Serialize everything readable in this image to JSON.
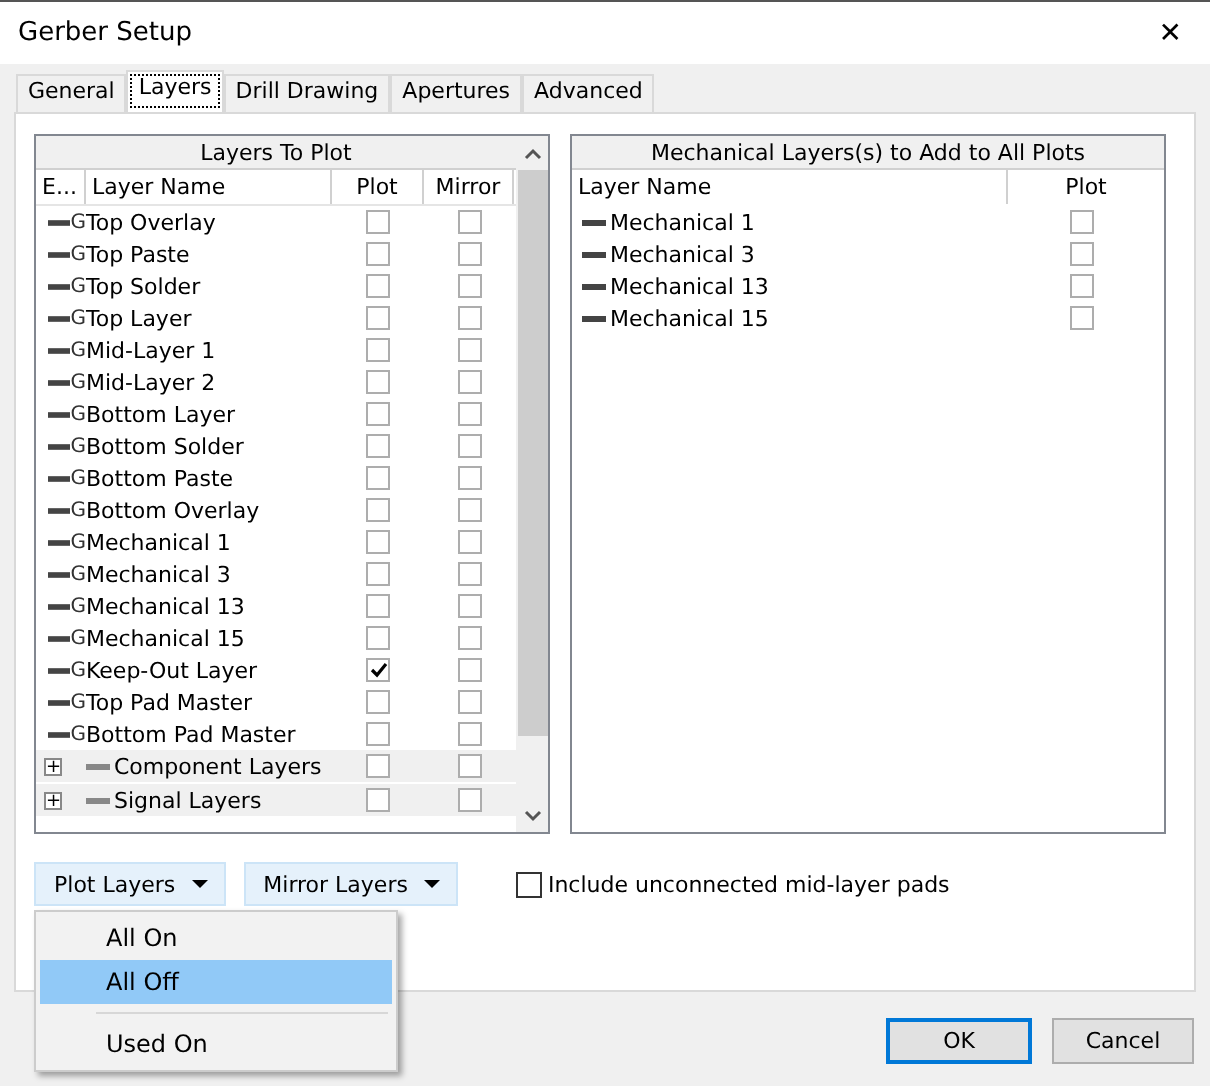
{
  "window": {
    "title": "Gerber Setup",
    "close": "✕"
  },
  "tabs": [
    {
      "label": "General",
      "selected": false
    },
    {
      "label": "Layers",
      "selected": true
    },
    {
      "label": "Drill Drawing",
      "selected": false
    },
    {
      "label": "Apertures",
      "selected": false
    },
    {
      "label": "Advanced",
      "selected": false
    }
  ],
  "plot_table": {
    "title": "Layers To Plot",
    "columns": [
      "E...",
      "Layer Name",
      "Plot",
      "Mirror"
    ],
    "rows": [
      {
        "kind": "layer",
        "prefix": "G",
        "name": "Top Overlay",
        "plot": false,
        "mirror": false
      },
      {
        "kind": "layer",
        "prefix": "G",
        "name": "Top Paste",
        "plot": false,
        "mirror": false
      },
      {
        "kind": "layer",
        "prefix": "G",
        "name": "Top Solder",
        "plot": false,
        "mirror": false
      },
      {
        "kind": "layer",
        "prefix": "G",
        "name": "Top Layer",
        "plot": false,
        "mirror": false
      },
      {
        "kind": "layer",
        "prefix": "G",
        "name": "Mid-Layer 1",
        "plot": false,
        "mirror": false
      },
      {
        "kind": "layer",
        "prefix": "G",
        "name": "Mid-Layer 2",
        "plot": false,
        "mirror": false
      },
      {
        "kind": "layer",
        "prefix": "G",
        "name": "Bottom Layer",
        "plot": false,
        "mirror": false
      },
      {
        "kind": "layer",
        "prefix": "G",
        "name": "Bottom Solder",
        "plot": false,
        "mirror": false
      },
      {
        "kind": "layer",
        "prefix": "G",
        "name": "Bottom Paste",
        "plot": false,
        "mirror": false
      },
      {
        "kind": "layer",
        "prefix": "G",
        "name": "Bottom Overlay",
        "plot": false,
        "mirror": false
      },
      {
        "kind": "layer",
        "prefix": "G",
        "name": "Mechanical 1",
        "plot": false,
        "mirror": false
      },
      {
        "kind": "layer",
        "prefix": "G",
        "name": "Mechanical 3",
        "plot": false,
        "mirror": false
      },
      {
        "kind": "layer",
        "prefix": "G",
        "name": "Mechanical 13",
        "plot": false,
        "mirror": false
      },
      {
        "kind": "layer",
        "prefix": "G",
        "name": "Mechanical 15",
        "plot": false,
        "mirror": false
      },
      {
        "kind": "layer",
        "prefix": "G",
        "name": "Keep-Out Layer",
        "plot": true,
        "mirror": false
      },
      {
        "kind": "layer",
        "prefix": "G",
        "name": "Top Pad Master",
        "plot": false,
        "mirror": false
      },
      {
        "kind": "layer",
        "prefix": "G",
        "name": "Bottom Pad Master",
        "plot": false,
        "mirror": false
      },
      {
        "kind": "group",
        "expand": "+",
        "name": "Component Layers",
        "plot": false,
        "mirror": false
      },
      {
        "kind": "group",
        "expand": "+",
        "name": "Signal Layers",
        "plot": false,
        "mirror": false
      }
    ]
  },
  "mech_table": {
    "title": "Mechanical Layers(s) to Add to All Plots",
    "columns": [
      "Layer Name",
      "Plot"
    ],
    "rows": [
      {
        "name": "Mechanical 1",
        "plot": false
      },
      {
        "name": "Mechanical 3",
        "plot": false
      },
      {
        "name": "Mechanical 13",
        "plot": false
      },
      {
        "name": "Mechanical 15",
        "plot": false
      }
    ]
  },
  "plot_layers_button": {
    "label": "Plot Layers"
  },
  "mirror_layers_button": {
    "label": "Mirror Layers"
  },
  "include_pads": {
    "label": "Include unconnected mid-layer pads",
    "checked": false
  },
  "menu": [
    {
      "kind": "item",
      "label": "All On",
      "selected": false
    },
    {
      "kind": "item",
      "label": "All Off",
      "selected": true
    },
    {
      "kind": "separator"
    },
    {
      "kind": "item",
      "label": "Used On",
      "selected": false
    }
  ],
  "buttons": [
    "OK",
    "Cancel"
  ]
}
